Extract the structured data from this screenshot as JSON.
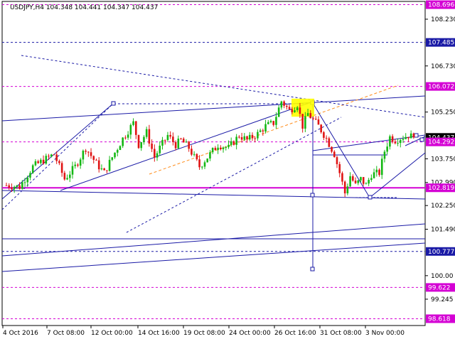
{
  "header": {
    "symbol_line": "USDJPY,H4  104.348 104.441 104.347 104.437"
  },
  "chart_data": {
    "type": "candlestick",
    "symbol": "USDJPY",
    "timeframe": "H4",
    "ohlc_last": {
      "open": 104.348,
      "high": 104.441,
      "low": 104.347,
      "close": 104.437
    },
    "ylim": [
      98.4,
      108.8
    ],
    "y_ticks": [
      {
        "value": 108.23,
        "label": "108.230"
      },
      {
        "value": 106.73,
        "label": "106.730"
      },
      {
        "value": 105.25,
        "label": "105.250"
      },
      {
        "value": 103.75,
        "label": "103.750"
      },
      {
        "value": 102.99,
        "label": "102.990"
      },
      {
        "value": 102.25,
        "label": "102.250"
      },
      {
        "value": 101.49,
        "label": "101.490"
      },
      {
        "value": 100.0,
        "label": "100.00"
      },
      {
        "value": 99.245,
        "label": "99.245"
      }
    ],
    "price_levels": [
      {
        "value": 108.696,
        "label": "108.696",
        "style": "dashed",
        "color": "#d400d4"
      },
      {
        "value": 107.485,
        "label": "107.485",
        "style": "dashed",
        "color": "#1a1aa6"
      },
      {
        "value": 106.072,
        "label": "106.072",
        "style": "dashed",
        "color": "#d400d4"
      },
      {
        "value": 104.437,
        "label": "104.437",
        "style": "none",
        "color": "#000000"
      },
      {
        "value": 104.292,
        "label": "104.292",
        "style": "dashed",
        "color": "#d400d4"
      },
      {
        "value": 102.819,
        "label": "102.819",
        "style": "solid",
        "color": "#d400d4"
      },
      {
        "value": 100.777,
        "label": "100.777",
        "style": "dashed",
        "color": "#1a1aa6"
      },
      {
        "value": 99.622,
        "label": "99.622",
        "style": "dashed",
        "color": "#d400d4"
      },
      {
        "value": 98.618,
        "label": "98.618",
        "style": "dashed",
        "color": "#d400d4"
      }
    ],
    "x_labels": [
      "4 Oct 2016",
      "7 Oct 08:00",
      "12 Oct 00:00",
      "14 Oct 16:00",
      "19 Oct 08:00",
      "24 Oct 00:00",
      "26 Oct 16:00",
      "31 Oct 08:00",
      "3 Nov 00:00"
    ],
    "candle_path": [
      [
        0,
        102.9
      ],
      [
        5,
        102.85
      ],
      [
        10,
        103.5
      ],
      [
        14,
        103.7
      ],
      [
        18,
        103.9
      ],
      [
        22,
        103.1
      ],
      [
        26,
        103.5
      ],
      [
        30,
        104.1
      ],
      [
        34,
        103.6
      ],
      [
        37,
        103.3
      ],
      [
        40,
        103.8
      ],
      [
        44,
        104.4
      ],
      [
        48,
        104.9
      ],
      [
        50,
        104.2
      ],
      [
        53,
        104.6
      ],
      [
        56,
        103.8
      ],
      [
        58,
        104.1
      ],
      [
        61,
        104.5
      ],
      [
        64,
        104.2
      ],
      [
        66,
        104.35
      ],
      [
        69,
        104.1
      ],
      [
        73,
        103.5
      ],
      [
        76,
        103.8
      ],
      [
        80,
        104.2
      ],
      [
        84,
        104.1
      ],
      [
        88,
        104.5
      ],
      [
        91,
        104.35
      ],
      [
        95,
        104.55
      ],
      [
        98,
        104.8
      ],
      [
        101,
        104.9
      ],
      [
        104,
        105.6
      ],
      [
        107,
        105.3
      ],
      [
        110,
        105.5
      ],
      [
        112,
        104.8
      ],
      [
        114,
        105.2
      ],
      [
        116,
        105.0
      ],
      [
        118,
        104.8
      ],
      [
        121,
        104.4
      ],
      [
        124,
        103.9
      ],
      [
        126,
        103.3
      ],
      [
        128,
        102.65
      ],
      [
        130,
        103.2
      ],
      [
        132,
        102.9
      ],
      [
        134,
        103.1
      ],
      [
        136,
        102.9
      ],
      [
        138,
        103.25
      ],
      [
        141,
        103.3
      ],
      [
        143,
        104.0
      ],
      [
        145,
        104.45
      ],
      [
        147,
        104.35
      ],
      [
        150,
        104.45
      ],
      [
        152,
        104.5
      ],
      [
        154,
        104.44
      ]
    ],
    "total_bars": 154
  }
}
